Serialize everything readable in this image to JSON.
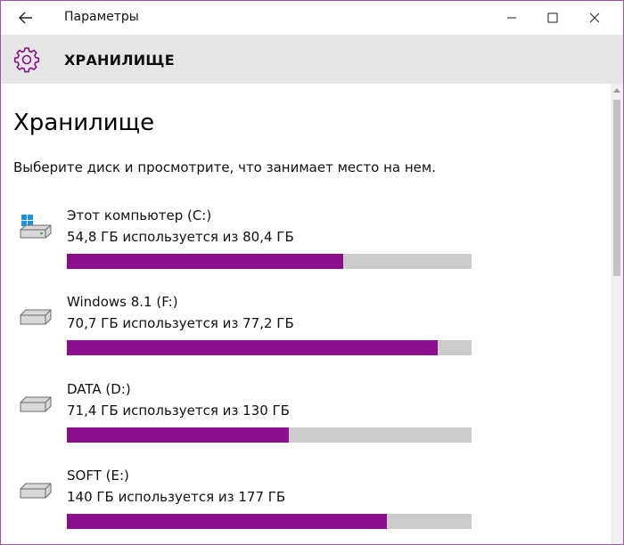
{
  "window": {
    "title": "Параметры",
    "back_icon": "back-arrow-icon",
    "minimize_icon": "minimize-icon",
    "maximize_icon": "maximize-icon",
    "close_icon": "close-icon"
  },
  "header": {
    "icon": "gear-icon",
    "title": "ХРАНИЛИЩЕ",
    "accent_color": "#8a0f8c"
  },
  "main": {
    "title": "Хранилище",
    "description": "Выберите диск и просмотрите, что занимает место на нем.",
    "drives": [
      {
        "name": "Этот компьютер (C:)",
        "usage": "54,8 ГБ используется из 80,4 ГБ",
        "used_fraction": 0.682,
        "icon": "windows-drive-icon"
      },
      {
        "name": "Windows 8.1 (F:)",
        "usage": "70,7 ГБ используется из 77,2 ГБ",
        "used_fraction": 0.916,
        "icon": "drive-icon"
      },
      {
        "name": "DATA (D:)",
        "usage": "71,4 ГБ используется из 130 ГБ",
        "used_fraction": 0.549,
        "icon": "drive-icon"
      },
      {
        "name": "SOFT (E:)",
        "usage": "140 ГБ используется из 177 ГБ",
        "used_fraction": 0.791,
        "icon": "drive-icon"
      }
    ]
  },
  "colors": {
    "bar_fill": "#8a0f8c",
    "bar_track": "#cccccc",
    "header_bg": "#e6e6e6"
  }
}
